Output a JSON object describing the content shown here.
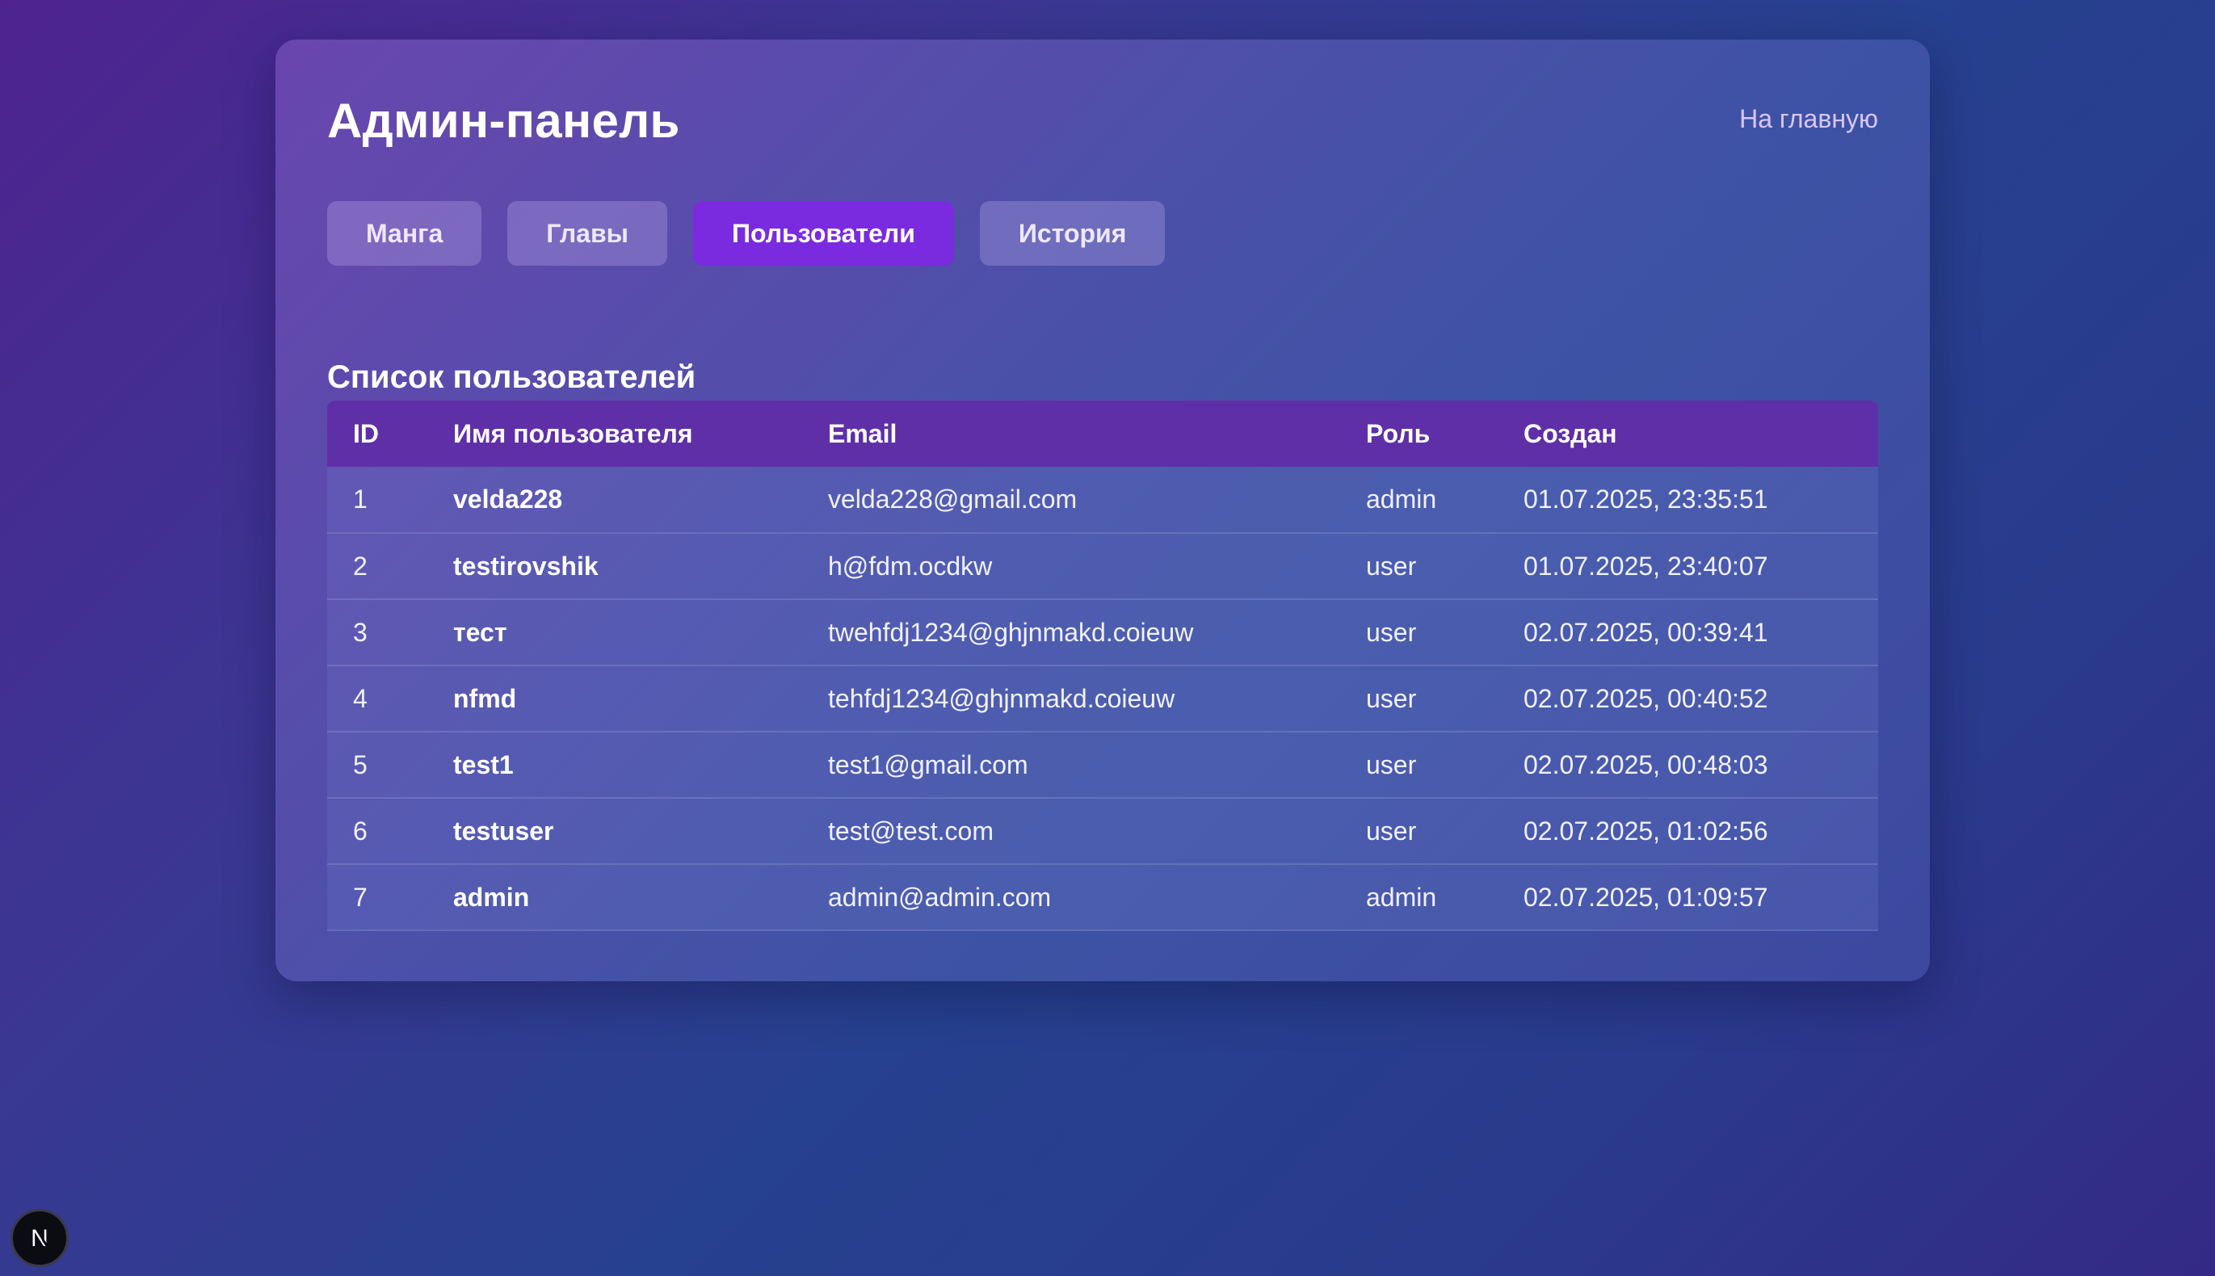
{
  "header": {
    "title": "Админ-панель",
    "home_link": "На главную"
  },
  "tabs": [
    {
      "label": "Манга",
      "active": false
    },
    {
      "label": "Главы",
      "active": false
    },
    {
      "label": "Пользователи",
      "active": true
    },
    {
      "label": "История",
      "active": false
    }
  ],
  "section": {
    "title": "Список пользователей"
  },
  "table": {
    "columns": [
      "ID",
      "Имя пользователя",
      "Email",
      "Роль",
      "Создан"
    ],
    "rows": [
      {
        "id": "1",
        "username": "velda228",
        "email": "velda228@gmail.com",
        "role": "admin",
        "created": "01.07.2025, 23:35:51"
      },
      {
        "id": "2",
        "username": "testirovshik",
        "email": "h@fdm.ocdkw",
        "role": "user",
        "created": "01.07.2025, 23:40:07"
      },
      {
        "id": "3",
        "username": "тест",
        "email": "twehfdj1234@ghjnmakd.coieuw",
        "role": "user",
        "created": "02.07.2025, 00:39:41"
      },
      {
        "id": "4",
        "username": "nfmd",
        "email": "tehfdj1234@ghjnmakd.coieuw",
        "role": "user",
        "created": "02.07.2025, 00:40:52"
      },
      {
        "id": "5",
        "username": "test1",
        "email": "test1@gmail.com",
        "role": "user",
        "created": "02.07.2025, 00:48:03"
      },
      {
        "id": "6",
        "username": "testuser",
        "email": "test@test.com",
        "role": "user",
        "created": "02.07.2025, 01:02:56"
      },
      {
        "id": "7",
        "username": "admin",
        "email": "admin@admin.com",
        "role": "admin",
        "created": "02.07.2025, 01:09:57"
      }
    ]
  },
  "badge": {
    "letter": "N",
    "icon": "nextjs-logo-icon"
  },
  "colors": {
    "accent": "#7a2be0",
    "table_header": "#5f2fa8",
    "link": "#d9c6ff"
  }
}
